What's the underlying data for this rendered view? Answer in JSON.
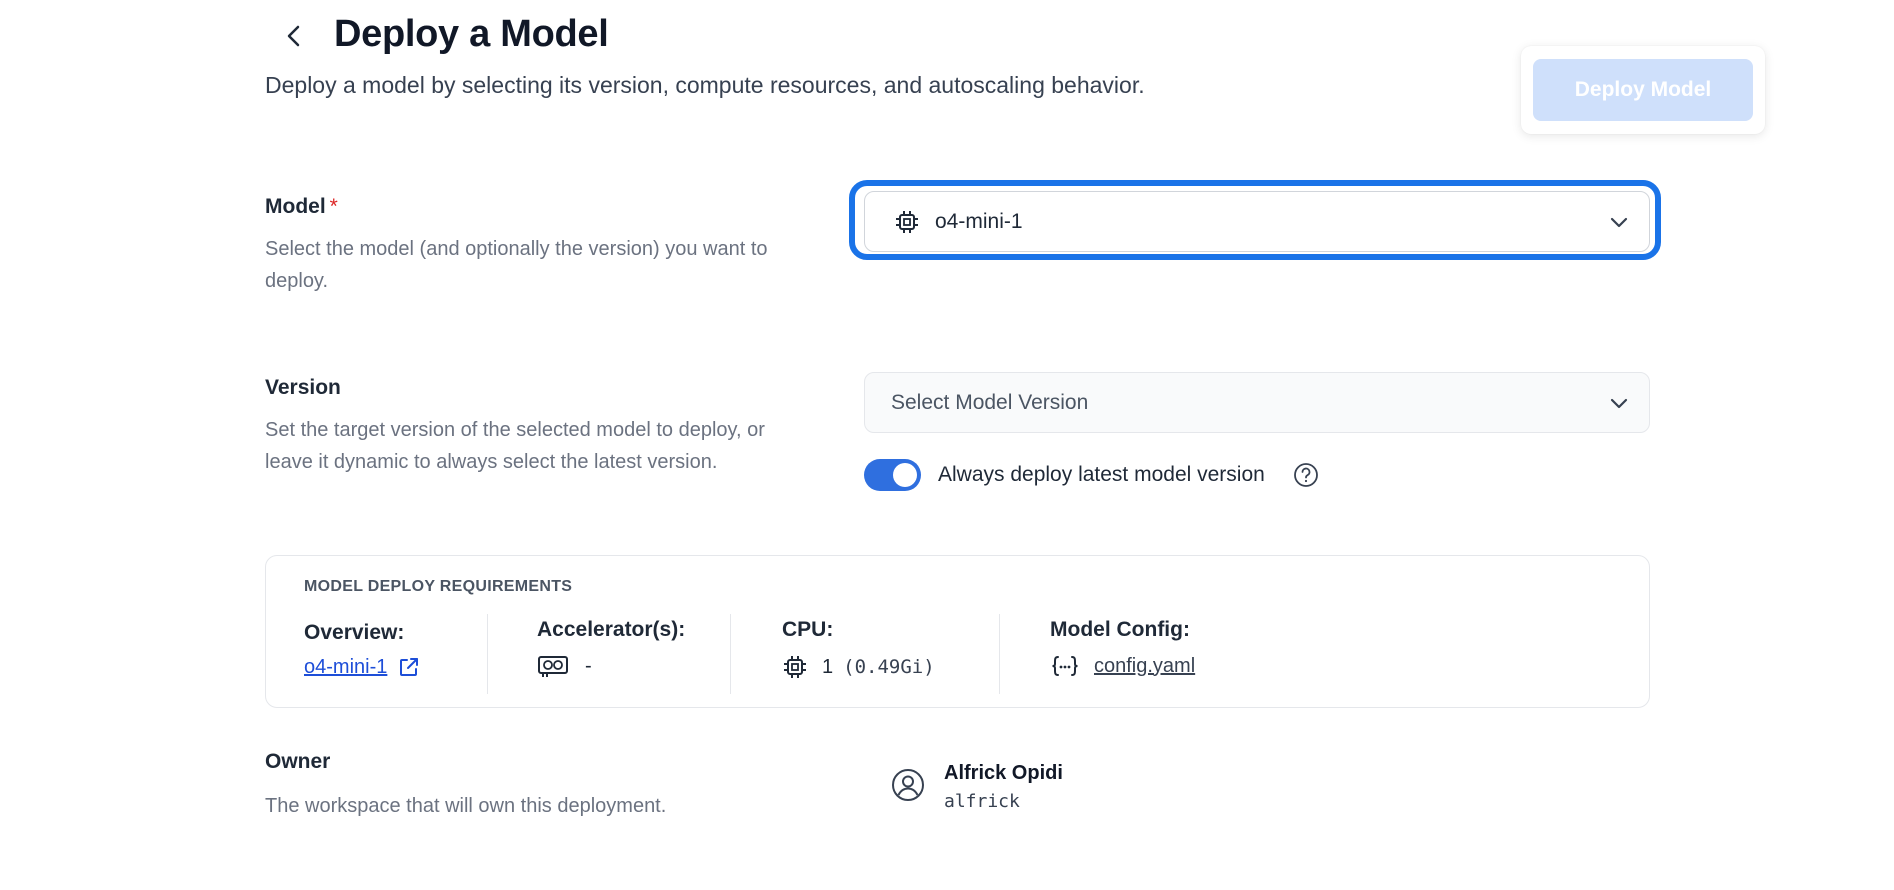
{
  "header": {
    "title": "Deploy a Model",
    "subtitle": "Deploy a model by selecting its version, compute resources, and autoscaling behavior.",
    "deploy_button": "Deploy Model"
  },
  "model": {
    "label": "Model",
    "required_mark": "*",
    "description": "Select the model (and optionally the version) you want to deploy.",
    "selected": "o4-mini-1"
  },
  "version": {
    "label": "Version",
    "description": "Set the target version of the selected model to deploy, or leave it dynamic to always select the latest version.",
    "placeholder": "Select Model Version",
    "toggle_label": "Always deploy latest model version",
    "toggle_on": true
  },
  "requirements": {
    "title": "MODEL DEPLOY REQUIREMENTS",
    "overview_label": "Overview:",
    "overview_value": "o4-mini-1",
    "accelerator_label": "Accelerator(s):",
    "accelerator_value": "-",
    "cpu_label": "CPU:",
    "cpu_value": "1",
    "cpu_memory": "(0.49Gi)",
    "config_label": "Model Config:",
    "config_value": "config.yaml"
  },
  "owner": {
    "label": "Owner",
    "description": "The workspace that will own this deployment.",
    "name": "Alfrick Opidi",
    "handle": "alfrick"
  },
  "colors": {
    "accent": "#1a73e8",
    "toggle": "#2f6fdf",
    "deploy_button_disabled": "#cfe0fb",
    "required": "#dc2626",
    "link": "#1d4ed8"
  }
}
